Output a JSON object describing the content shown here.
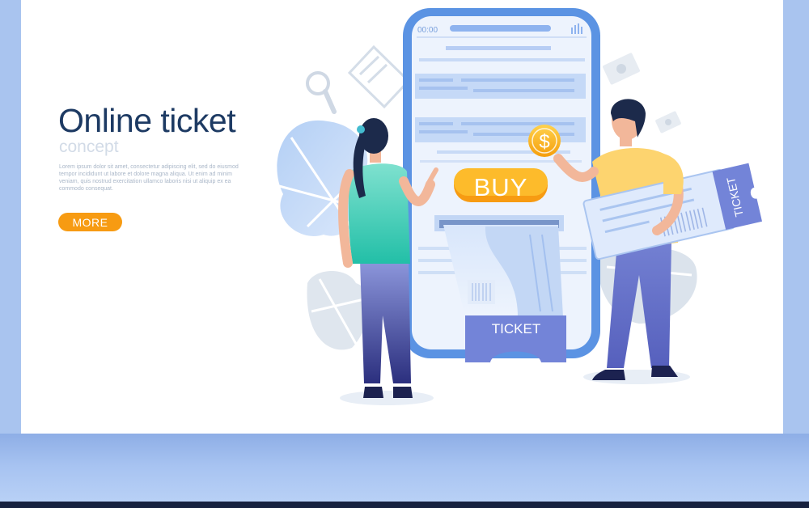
{
  "hero": {
    "title": "Online ticket",
    "subtitle": "concept",
    "body": "Lorem ipsum dolor sit amet, consectetur adipiscing elit, sed do eiusmod tempor incididunt ut labore et dolore magna aliqua. Ut enim ad minim veniam, quis nostrud exercitation ullamco laboris nisi ut aliquip ex ea commodo consequat.",
    "more_label": "MORE"
  },
  "phone": {
    "status_time": "00:00",
    "buy_label": "BUY",
    "ticket_label": "TICKET",
    "coin_symbol": "$"
  },
  "held_ticket": {
    "label": "TICKET"
  },
  "colors": {
    "title": "#1d3a63",
    "accent_orange": "#f79b12",
    "phone_blue": "#5b93e3",
    "ticket_blue": "#7384d8",
    "frame_blue": "#a9c4ef"
  },
  "icons": [
    "search-icon",
    "dollar-coin-icon",
    "signal-icon",
    "banknote-icon"
  ]
}
